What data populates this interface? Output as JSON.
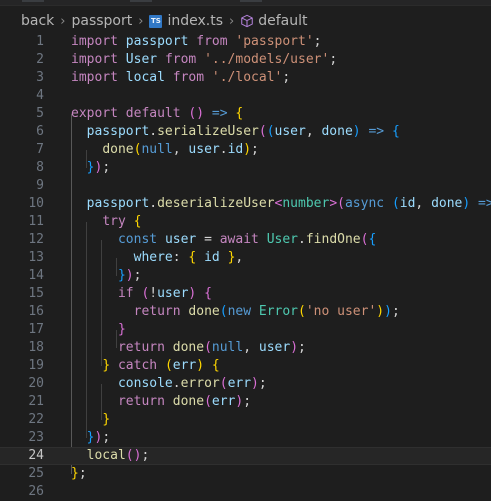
{
  "breadcrumb": {
    "items": [
      "back",
      "passport",
      "index.ts",
      "default"
    ],
    "file_icon_text": "TS"
  },
  "colors": {
    "keyword": "#c586c0",
    "storage": "#569cd6",
    "variable": "#9cdcfe",
    "function": "#dcdcaa",
    "string": "#ce9178",
    "type": "#4ec9b0",
    "bracket1": "#ffd700",
    "bracket2": "#da70d6",
    "bracket3": "#179fff",
    "background": "#1e1e1e"
  },
  "editor": {
    "current_line": 24,
    "lines": [
      {
        "n": "1",
        "tokens": [
          [
            "t-kw",
            "import"
          ],
          [
            "t-plain",
            " "
          ],
          [
            "t-var",
            "passport"
          ],
          [
            "t-plain",
            " "
          ],
          [
            "t-kw",
            "from"
          ],
          [
            "t-plain",
            " "
          ],
          [
            "t-str",
            "'passport'"
          ],
          [
            "t-plain",
            ";"
          ]
        ]
      },
      {
        "n": "2",
        "tokens": [
          [
            "t-kw",
            "import"
          ],
          [
            "t-plain",
            " "
          ],
          [
            "t-var",
            "User"
          ],
          [
            "t-plain",
            " "
          ],
          [
            "t-kw",
            "from"
          ],
          [
            "t-plain",
            " "
          ],
          [
            "t-str",
            "'../models/user'"
          ],
          [
            "t-plain",
            ";"
          ]
        ]
      },
      {
        "n": "3",
        "tokens": [
          [
            "t-kw",
            "import"
          ],
          [
            "t-plain",
            " "
          ],
          [
            "t-var",
            "local"
          ],
          [
            "t-plain",
            " "
          ],
          [
            "t-kw",
            "from"
          ],
          [
            "t-plain",
            " "
          ],
          [
            "t-str",
            "'./local'"
          ],
          [
            "t-plain",
            ";"
          ]
        ]
      },
      {
        "n": "4",
        "tokens": []
      },
      {
        "n": "5",
        "tokens": [
          [
            "t-kw",
            "export"
          ],
          [
            "t-plain",
            " "
          ],
          [
            "t-kw",
            "default"
          ],
          [
            "t-plain",
            " "
          ],
          [
            "t-b2",
            "()"
          ],
          [
            "t-plain",
            " "
          ],
          [
            "t-kw2",
            "=>"
          ],
          [
            "t-plain",
            " "
          ],
          [
            "t-b1",
            "{"
          ]
        ]
      },
      {
        "n": "6",
        "tokens": [
          [
            "t-plain",
            "  "
          ],
          [
            "t-var",
            "passport"
          ],
          [
            "t-plain",
            "."
          ],
          [
            "t-fn",
            "serializeUser"
          ],
          [
            "t-b2",
            "("
          ],
          [
            "t-b3",
            "("
          ],
          [
            "t-var",
            "user"
          ],
          [
            "t-plain",
            ", "
          ],
          [
            "t-var",
            "done"
          ],
          [
            "t-b3",
            ")"
          ],
          [
            "t-plain",
            " "
          ],
          [
            "t-kw2",
            "=>"
          ],
          [
            "t-plain",
            " "
          ],
          [
            "t-b3",
            "{"
          ]
        ]
      },
      {
        "n": "7",
        "tokens": [
          [
            "t-plain",
            "    "
          ],
          [
            "t-fn",
            "done"
          ],
          [
            "t-b1",
            "("
          ],
          [
            "t-kw2",
            "null"
          ],
          [
            "t-plain",
            ", "
          ],
          [
            "t-var",
            "user"
          ],
          [
            "t-plain",
            "."
          ],
          [
            "t-var",
            "id"
          ],
          [
            "t-b1",
            ")"
          ],
          [
            "t-plain",
            ";"
          ]
        ]
      },
      {
        "n": "8",
        "tokens": [
          [
            "t-plain",
            "  "
          ],
          [
            "t-b3",
            "}"
          ],
          [
            "t-b2",
            ")"
          ],
          [
            "t-plain",
            ";"
          ]
        ]
      },
      {
        "n": "9",
        "tokens": []
      },
      {
        "n": "10",
        "tokens": [
          [
            "t-plain",
            "  "
          ],
          [
            "t-var",
            "passport"
          ],
          [
            "t-plain",
            "."
          ],
          [
            "t-fn",
            "deserializeUser"
          ],
          [
            "t-b2",
            "<"
          ],
          [
            "t-type",
            "number"
          ],
          [
            "t-b2",
            ">"
          ],
          [
            "t-b2",
            "("
          ],
          [
            "t-kw2",
            "async"
          ],
          [
            "t-plain",
            " "
          ],
          [
            "t-b3",
            "("
          ],
          [
            "t-var",
            "id"
          ],
          [
            "t-plain",
            ", "
          ],
          [
            "t-var",
            "done"
          ],
          [
            "t-b3",
            ")"
          ],
          [
            "t-plain",
            " "
          ],
          [
            "t-kw2",
            "=>"
          ],
          [
            "t-plain",
            " "
          ],
          [
            "t-b3",
            "{"
          ]
        ]
      },
      {
        "n": "11",
        "tokens": [
          [
            "t-plain",
            "    "
          ],
          [
            "t-kw",
            "try"
          ],
          [
            "t-plain",
            " "
          ],
          [
            "t-b1",
            "{"
          ]
        ]
      },
      {
        "n": "12",
        "tokens": [
          [
            "t-plain",
            "      "
          ],
          [
            "t-kw2",
            "const"
          ],
          [
            "t-plain",
            " "
          ],
          [
            "t-var",
            "user"
          ],
          [
            "t-plain",
            " = "
          ],
          [
            "t-kw",
            "await"
          ],
          [
            "t-plain",
            " "
          ],
          [
            "t-type",
            "User"
          ],
          [
            "t-plain",
            "."
          ],
          [
            "t-fn",
            "findOne"
          ],
          [
            "t-b2",
            "("
          ],
          [
            "t-b3",
            "{"
          ]
        ]
      },
      {
        "n": "13",
        "tokens": [
          [
            "t-plain",
            "        "
          ],
          [
            "t-var",
            "where"
          ],
          [
            "t-plain",
            ": "
          ],
          [
            "t-b1",
            "{"
          ],
          [
            "t-plain",
            " "
          ],
          [
            "t-var",
            "id"
          ],
          [
            "t-plain",
            " "
          ],
          [
            "t-b1",
            "}"
          ],
          [
            "t-plain",
            ","
          ]
        ]
      },
      {
        "n": "14",
        "tokens": [
          [
            "t-plain",
            "      "
          ],
          [
            "t-b3",
            "}"
          ],
          [
            "t-b2",
            ")"
          ],
          [
            "t-plain",
            ";"
          ]
        ]
      },
      {
        "n": "15",
        "tokens": [
          [
            "t-plain",
            "      "
          ],
          [
            "t-kw",
            "if"
          ],
          [
            "t-plain",
            " "
          ],
          [
            "t-b2",
            "("
          ],
          [
            "t-plain",
            "!"
          ],
          [
            "t-var",
            "user"
          ],
          [
            "t-b2",
            ")"
          ],
          [
            "t-plain",
            " "
          ],
          [
            "t-b2",
            "{"
          ]
        ]
      },
      {
        "n": "16",
        "tokens": [
          [
            "t-plain",
            "        "
          ],
          [
            "t-kw",
            "return"
          ],
          [
            "t-plain",
            " "
          ],
          [
            "t-fn",
            "done"
          ],
          [
            "t-b3",
            "("
          ],
          [
            "t-kw2",
            "new"
          ],
          [
            "t-plain",
            " "
          ],
          [
            "t-type",
            "Error"
          ],
          [
            "t-b1",
            "("
          ],
          [
            "t-str",
            "'no user'"
          ],
          [
            "t-b1",
            ")"
          ],
          [
            "t-b3",
            ")"
          ],
          [
            "t-plain",
            ";"
          ]
        ]
      },
      {
        "n": "17",
        "tokens": [
          [
            "t-plain",
            "      "
          ],
          [
            "t-b2",
            "}"
          ]
        ]
      },
      {
        "n": "18",
        "tokens": [
          [
            "t-plain",
            "      "
          ],
          [
            "t-kw",
            "return"
          ],
          [
            "t-plain",
            " "
          ],
          [
            "t-fn",
            "done"
          ],
          [
            "t-b2",
            "("
          ],
          [
            "t-kw2",
            "null"
          ],
          [
            "t-plain",
            ", "
          ],
          [
            "t-var",
            "user"
          ],
          [
            "t-b2",
            ")"
          ],
          [
            "t-plain",
            ";"
          ]
        ]
      },
      {
        "n": "19",
        "tokens": [
          [
            "t-plain",
            "    "
          ],
          [
            "t-b1",
            "}"
          ],
          [
            "t-plain",
            " "
          ],
          [
            "t-kw",
            "catch"
          ],
          [
            "t-plain",
            " "
          ],
          [
            "t-b1",
            "("
          ],
          [
            "t-var",
            "err"
          ],
          [
            "t-b1",
            ")"
          ],
          [
            "t-plain",
            " "
          ],
          [
            "t-b1",
            "{"
          ]
        ]
      },
      {
        "n": "20",
        "tokens": [
          [
            "t-plain",
            "      "
          ],
          [
            "t-var",
            "console"
          ],
          [
            "t-plain",
            "."
          ],
          [
            "t-fn",
            "error"
          ],
          [
            "t-b2",
            "("
          ],
          [
            "t-var",
            "err"
          ],
          [
            "t-b2",
            ")"
          ],
          [
            "t-plain",
            ";"
          ]
        ]
      },
      {
        "n": "21",
        "tokens": [
          [
            "t-plain",
            "      "
          ],
          [
            "t-kw",
            "return"
          ],
          [
            "t-plain",
            " "
          ],
          [
            "t-fn",
            "done"
          ],
          [
            "t-b2",
            "("
          ],
          [
            "t-var",
            "err"
          ],
          [
            "t-b2",
            ")"
          ],
          [
            "t-plain",
            ";"
          ]
        ]
      },
      {
        "n": "22",
        "tokens": [
          [
            "t-plain",
            "    "
          ],
          [
            "t-b1",
            "}"
          ]
        ]
      },
      {
        "n": "23",
        "tokens": [
          [
            "t-plain",
            "  "
          ],
          [
            "t-b3",
            "}"
          ],
          [
            "t-b2",
            ")"
          ],
          [
            "t-plain",
            ";"
          ]
        ]
      },
      {
        "n": "24",
        "tokens": [
          [
            "t-plain",
            "  "
          ],
          [
            "t-fn",
            "local"
          ],
          [
            "t-b2",
            "()"
          ],
          [
            "t-plain",
            ";"
          ]
        ]
      },
      {
        "n": "25",
        "tokens": [
          [
            "t-b1",
            "}"
          ],
          [
            "t-plain",
            ";"
          ]
        ]
      },
      {
        "n": "26",
        "tokens": []
      }
    ]
  }
}
